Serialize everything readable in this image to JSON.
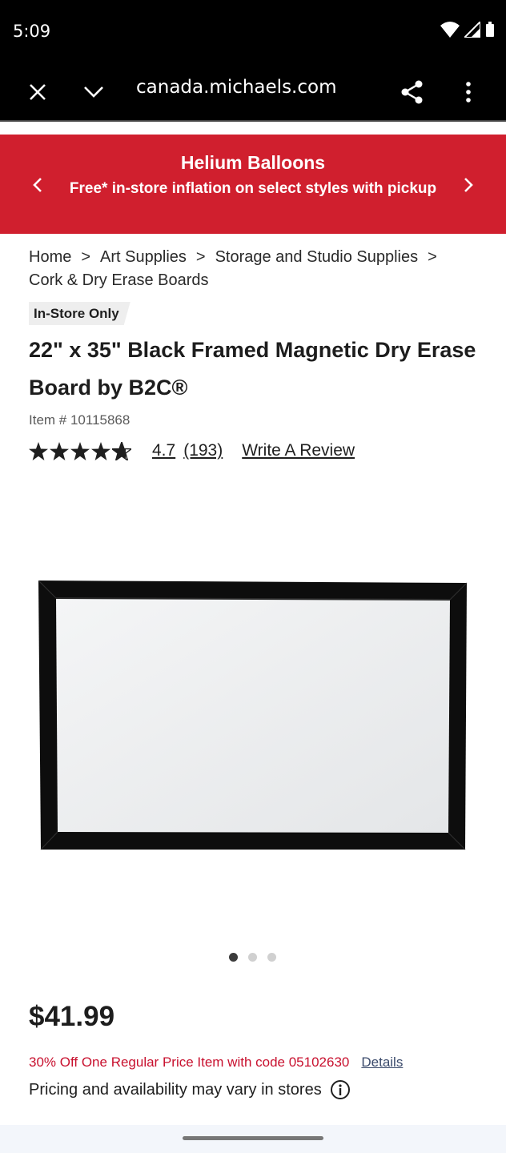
{
  "status": {
    "time": "5:09"
  },
  "browser": {
    "url": "canada.michaels.com"
  },
  "banner": {
    "title": "Helium Balloons",
    "subtitle": "Free* in-store inflation on select styles with pickup"
  },
  "breadcrumb": {
    "items": [
      "Home",
      "Art Supplies",
      "Storage and Studio Supplies",
      "Cork & Dry Erase Boards"
    ],
    "separator": ">"
  },
  "product": {
    "badge": "In-Store Only",
    "title": "22\" x 35\" Black Framed Magnetic Dry Erase Board by B2C®",
    "item_number": "Item # 10115868",
    "rating": "4.7",
    "review_count": "(193)",
    "write_review": "Write A Review",
    "price": "$41.99",
    "promo_text": "30% Off One Regular Price Item with code 05102630",
    "promo_details": "Details",
    "availability": "Pricing and availability may vary in stores"
  },
  "carousel": {
    "total": 3,
    "active_index": 1
  },
  "colors": {
    "brand_red": "#d01f2e",
    "promo_red": "#c8102e"
  }
}
